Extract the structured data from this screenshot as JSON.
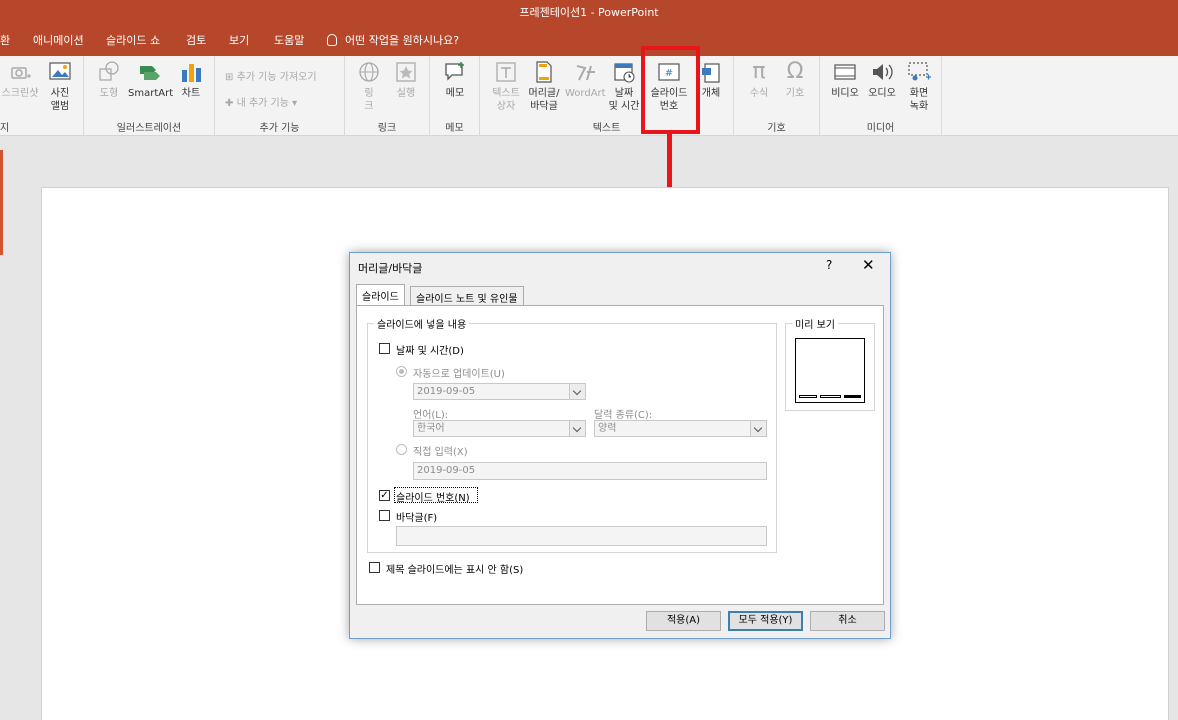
{
  "window": {
    "title": "프레젠테이션1  -  PowerPoint"
  },
  "ribbon_tabs": [
    "환",
    "애니메이션",
    "슬라이드 쇼",
    "검토",
    "보기",
    "도움말"
  ],
  "tell_me": "어떤 작업을 원하시나요?",
  "ribbon": {
    "images": {
      "screenshot": "스크린샷",
      "album_line1": "사진",
      "album_line2": "앨범",
      "group_label": "지"
    },
    "illustrations": {
      "shapes": "도형",
      "smartart": "SmartArt",
      "chart": "차트",
      "group_label": "일러스트레이션"
    },
    "addins": {
      "get": "추가 기능 가져오기",
      "mine": "내 추가 기능",
      "group_label": "추가 기능"
    },
    "links": {
      "link_line1": "링",
      "link_line2": "크",
      "action": "실행",
      "group_label": "링크"
    },
    "comments": {
      "comment": "메모",
      "group_label": "메모"
    },
    "text": {
      "textbox_line1": "텍스트",
      "textbox_line2": "상자",
      "headerfooter_line1": "머리글/",
      "headerfooter_line2": "바닥글",
      "wordart": "WordArt",
      "datetime_line1": "날짜",
      "datetime_line2": "및 시간",
      "slidenum_line1": "슬라이드",
      "slidenum_line2": "번호",
      "object": "개체",
      "group_label": "텍스트"
    },
    "symbols": {
      "equation": "수식",
      "symbol": "기호",
      "group_label": "기호"
    },
    "media": {
      "video": "비디오",
      "audio": "오디오",
      "screenrec_line1": "화면",
      "screenrec_line2": "녹화",
      "group_label": "미디어"
    }
  },
  "dialog": {
    "title": "머리글/바닥글",
    "help": "?",
    "close": "✕",
    "tabs": [
      "슬라이드",
      "슬라이드 노트 및 유인물"
    ],
    "fieldset_label": "슬라이드에 넣을 내용",
    "date_time": {
      "label": "날짜 및 시간(D)",
      "checked": false
    },
    "auto_update": {
      "label": "자동으로 업데이트(U)",
      "selected": true
    },
    "auto_date_value": "2019-09-05",
    "language_label": "언어(L):",
    "language_value": "한국어",
    "calendar_label": "달력 종류(C):",
    "calendar_value": "양력",
    "fixed": {
      "label": "직접 입력(X)",
      "selected": false
    },
    "fixed_value": "2019-09-05",
    "slide_number": {
      "label": "슬라이드 번호(N)",
      "checked": true
    },
    "footer": {
      "label": "바닥글(F)",
      "checked": false,
      "value": ""
    },
    "preview_label": "미리 보기",
    "dont_show_title": {
      "label": "제목 슬라이드에는 표시 안 함(S)",
      "checked": false
    },
    "buttons": {
      "apply": "적용(A)",
      "apply_all": "모두 적용(Y)",
      "cancel": "취소"
    }
  },
  "accent_colors": {
    "title_bar": "#b7472a",
    "highlight": "#e8151b",
    "dialog_border": "#6f9ecf"
  }
}
